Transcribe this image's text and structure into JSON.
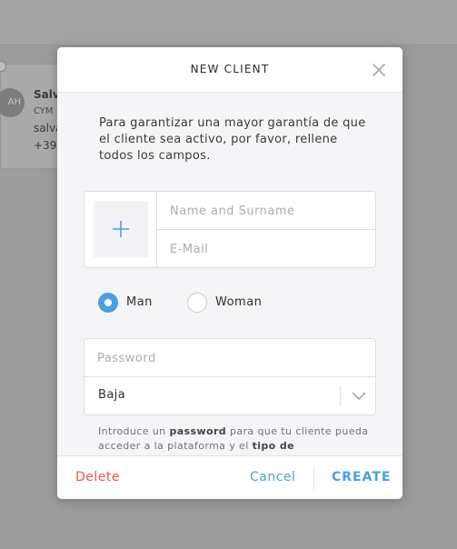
{
  "background": {
    "client_card": {
      "avatar_initials": "AH",
      "name": "Salv",
      "company": "CYM",
      "email": "salva",
      "phone": "+39"
    }
  },
  "modal": {
    "title": "NEW CLIENT",
    "intro": "Para garantizar una mayor garantía de que el cliente sea activo, por favor, rellene todos los campos.",
    "name_placeholder": "Name and Surname",
    "email_placeholder": "E-Mail",
    "gender": {
      "options": [
        "Man",
        "Woman"
      ],
      "selected": "Man"
    },
    "password_placeholder": "Password",
    "level_select_value": "Baja",
    "hint": {
      "p1": "Introduce un ",
      "b1": "password",
      "p2": " para que tu cliente pueda acceder a la plataforma y el ",
      "b2": "tipo de"
    },
    "footer": {
      "delete_label": "Delete",
      "cancel_label": "Cancel",
      "create_label": "CREATE"
    }
  },
  "colors": {
    "accent": "#4a9fe0",
    "danger": "#e2574c",
    "overlay": "#9c9c9c"
  },
  "icons": {
    "close": "close-icon",
    "add_photo": "plus-icon",
    "select_arrow": "chevron-down-icon"
  }
}
